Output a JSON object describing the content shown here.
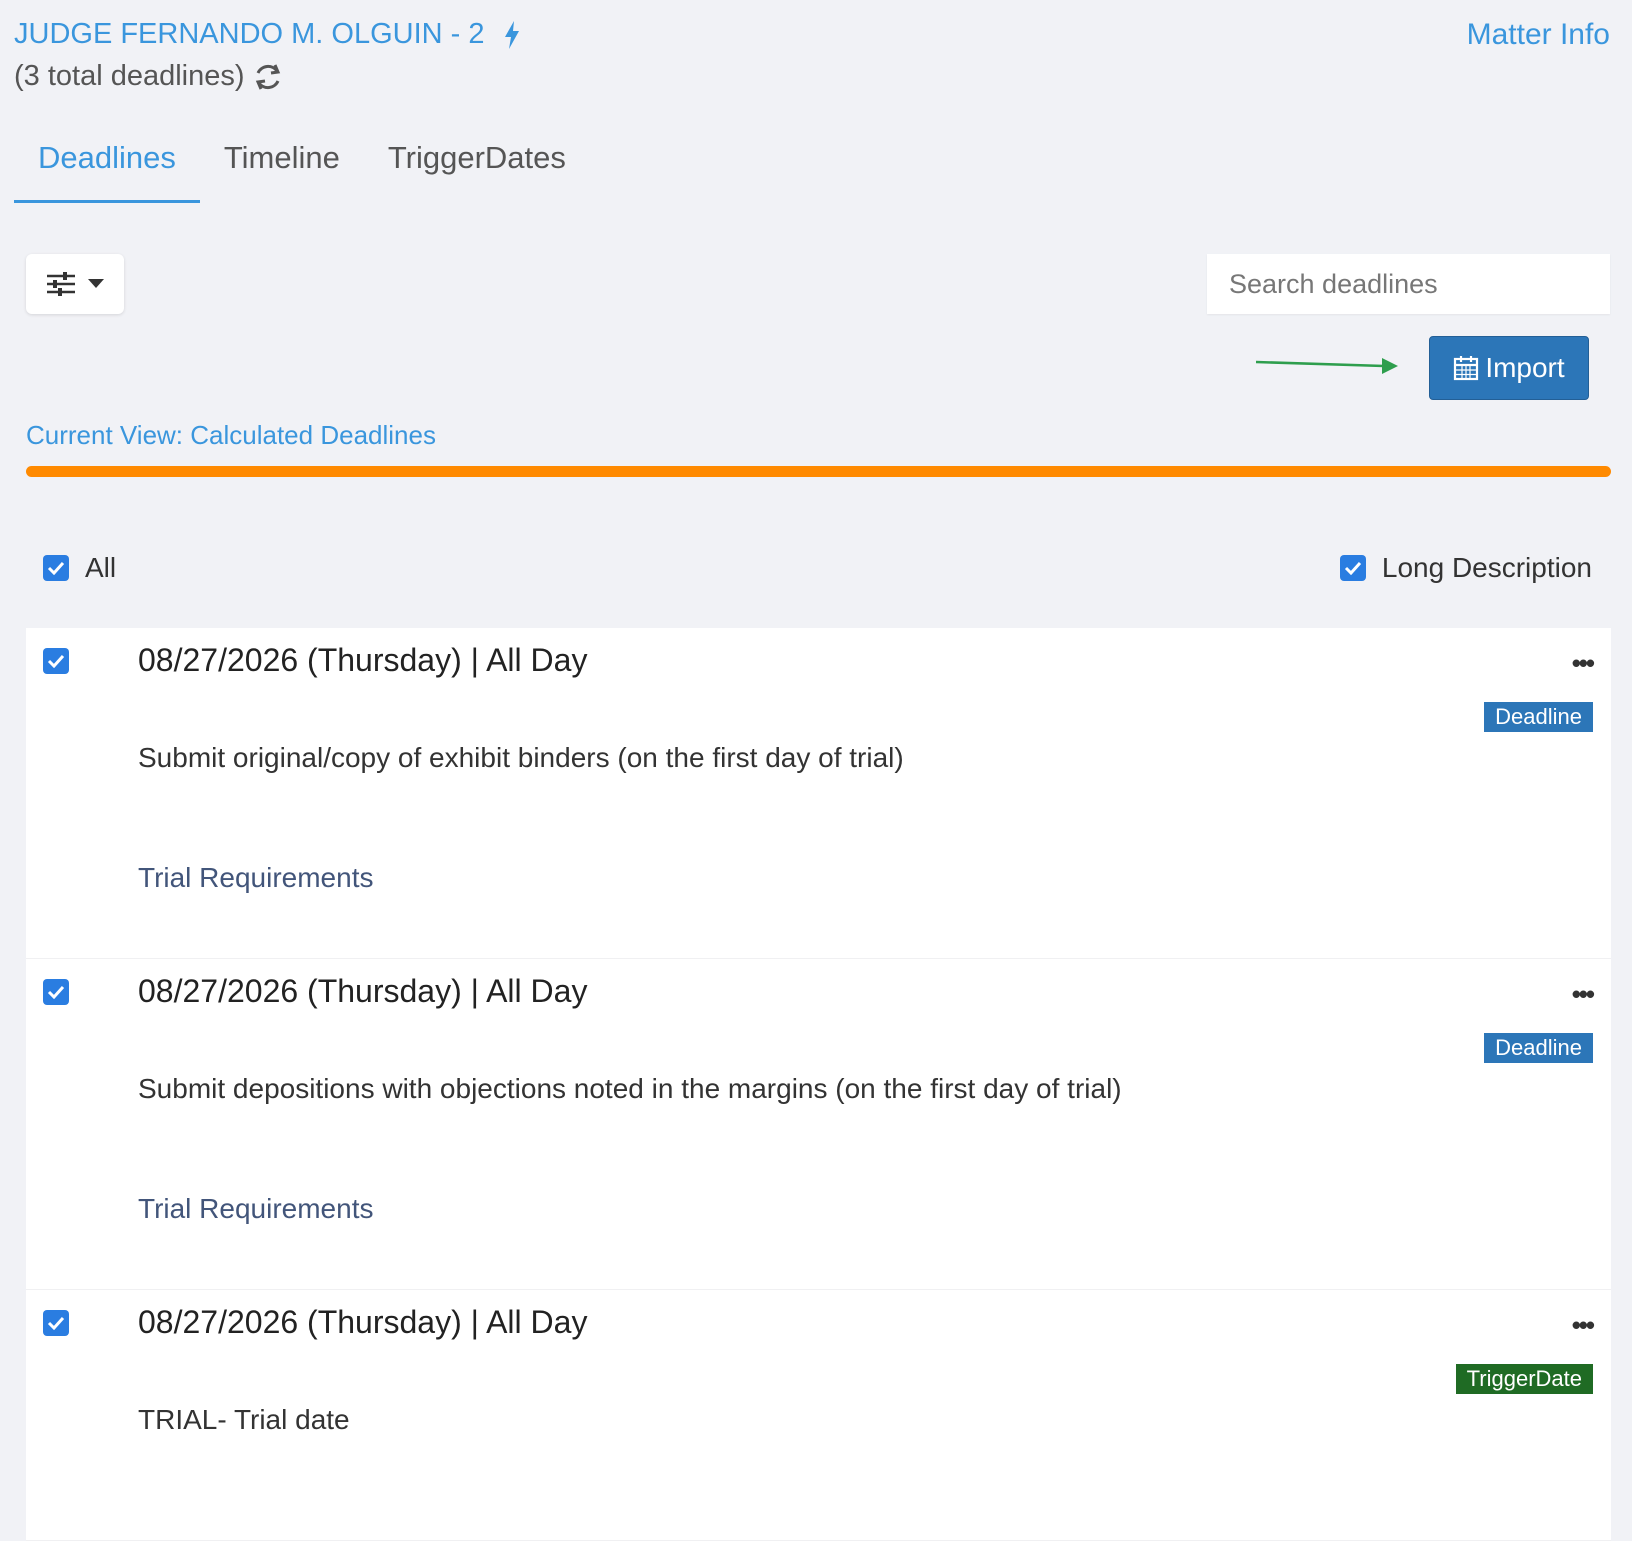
{
  "header": {
    "title": "JUDGE FERNANDO M. OLGUIN - 2",
    "subtitle": "(3 total deadlines)",
    "matter_info": "Matter Info"
  },
  "tabs": [
    {
      "label": "Deadlines",
      "active": true
    },
    {
      "label": "Timeline",
      "active": false
    },
    {
      "label": "TriggerDates",
      "active": false
    }
  ],
  "toolbar": {
    "search_placeholder": "Search deadlines",
    "import_label": "Import"
  },
  "current_view": "Current View: Calculated Deadlines",
  "options": {
    "all_label": "All",
    "all_checked": true,
    "long_desc_label": "Long Description",
    "long_desc_checked": true
  },
  "deadlines": [
    {
      "date": "08/27/2026 (Thursday)  |  All Day",
      "badge": "Deadline",
      "description": "Submit original/copy of exhibit binders (on the first day of trial)",
      "category": "Trial Requirements",
      "checked": true
    },
    {
      "date": "08/27/2026 (Thursday)  |  All Day",
      "badge": "Deadline",
      "description": "Submit depositions with objections noted in the margins (on the first day of trial)",
      "category": "Trial Requirements",
      "checked": true
    },
    {
      "date": "08/27/2026 (Thursday)  |  All Day",
      "badge": "TriggerDate",
      "description": "TRIAL- Trial date",
      "category": "",
      "checked": true
    }
  ],
  "colors": {
    "accent": "#3a96dd",
    "import_button": "#2c76b8",
    "progress_bar": "#ff8a00",
    "deadline_badge": "#2c76b8",
    "trigger_badge": "#1f6b24",
    "arrow": "#2e9e4d"
  },
  "icons": {
    "title": "lightning-bolt-icon",
    "subtitle": "refresh-icon",
    "filter": "sliders-icon",
    "import": "calendar-icon",
    "more": "ellipsis-icon"
  }
}
